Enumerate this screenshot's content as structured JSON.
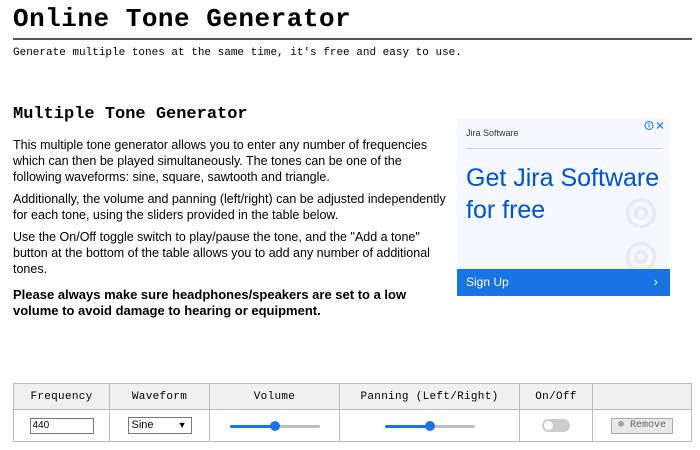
{
  "header": {
    "title": "Online Tone Generator",
    "tagline": "Generate multiple tones at the same time, it's free and easy to use."
  },
  "main": {
    "heading": "Multiple Tone Generator",
    "paragraphs": [
      "This multiple tone generator allows you to enter any number of frequencies which can then be played simultaneously. The tones can be one of the following waveforms: sine, square, sawtooth and triangle.",
      "Additionally, the volume and panning (left/right) can be adjusted independently for each tone, using the sliders provided in the table below.",
      "Use the On/Off toggle switch to play/pause the tone, and the \"Add a tone\" button at the bottom of the table allows you to add any number of additional tones."
    ],
    "warning": "Please always make sure headphones/speakers are set to a low volume to avoid damage to hearing or equipment."
  },
  "ad": {
    "brand": "Jira Software",
    "headline": "Get Jira Software for free",
    "cta": "Sign Up",
    "cta_arrow": "›",
    "info_icon": "info-icon",
    "close_icon": "close-icon",
    "accent_color": "#0052cc",
    "cta_color": "#1874e3"
  },
  "table": {
    "headers": [
      "Frequency",
      "Waveform",
      "Volume",
      "Panning (Left/Right)",
      "On/Off",
      ""
    ],
    "rows": [
      {
        "frequency": "440",
        "waveform": "Sine",
        "volume": 0.5,
        "panning": 0.5,
        "on": false,
        "remove_label": "Remove",
        "remove_icon": "⊗"
      }
    ],
    "slider_color": "#1a73e8"
  }
}
